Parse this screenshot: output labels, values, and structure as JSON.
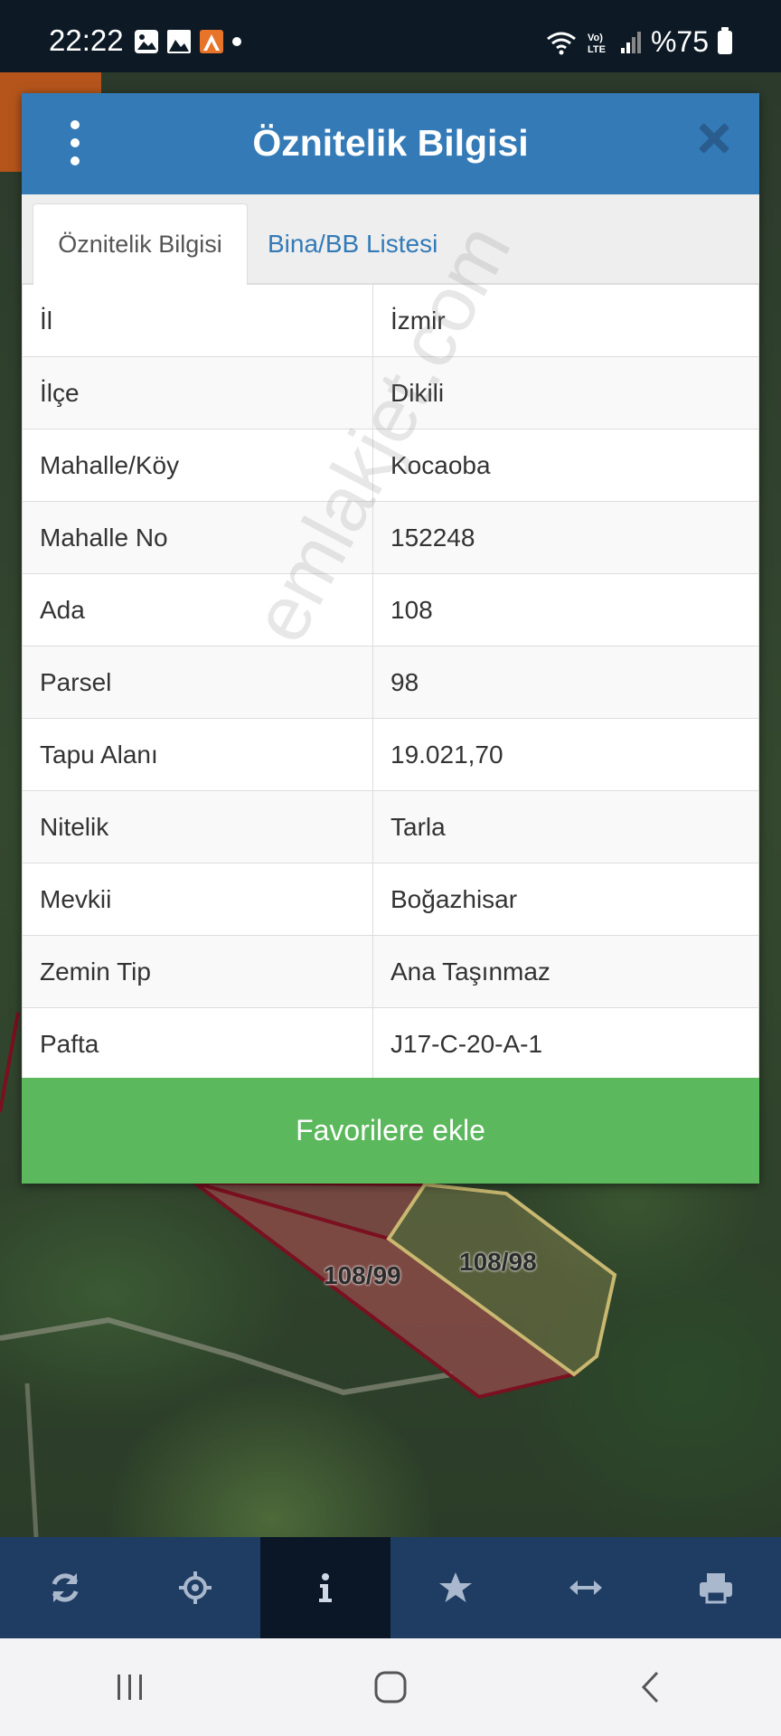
{
  "status_bar": {
    "time": "22:22",
    "battery": "%75",
    "icons": [
      "gallery-icon",
      "image-icon",
      "app-icon",
      "dot-icon",
      "wifi-icon",
      "volte-icon",
      "signal-icon",
      "battery-icon"
    ]
  },
  "dialog": {
    "title": "Öznitelik Bilgisi",
    "tabs": [
      {
        "label": "Öznitelik Bilgisi",
        "active": true
      },
      {
        "label": "Bina/BB Listesi",
        "active": false
      }
    ],
    "rows": [
      {
        "key": "İl",
        "value": "İzmir"
      },
      {
        "key": "İlçe",
        "value": "Dikili"
      },
      {
        "key": "Mahalle/Köy",
        "value": "Kocaoba"
      },
      {
        "key": "Mahalle No",
        "value": "152248"
      },
      {
        "key": "Ada",
        "value": "108"
      },
      {
        "key": "Parsel",
        "value": "98"
      },
      {
        "key": "Tapu Alanı",
        "value": "19.021,70"
      },
      {
        "key": "Nitelik",
        "value": "Tarla"
      },
      {
        "key": "Mevkii",
        "value": "Boğazhisar"
      },
      {
        "key": "Zemin Tip",
        "value": "Ana Taşınmaz"
      },
      {
        "key": "Pafta",
        "value": "J17-C-20-A-1"
      }
    ],
    "favorite_button": "Favorilere ekle"
  },
  "watermark": "emlakjet.com",
  "map": {
    "parcel_labels": [
      "108/99",
      "108/98"
    ]
  },
  "toolbar": {
    "items": [
      "refresh-icon",
      "locate-icon",
      "info-icon",
      "star-icon",
      "measure-icon",
      "print-icon"
    ],
    "active": "info-icon"
  },
  "colors": {
    "header": "#337ab7",
    "button": "#5cb85c",
    "toolbar": "#1f3c63"
  }
}
